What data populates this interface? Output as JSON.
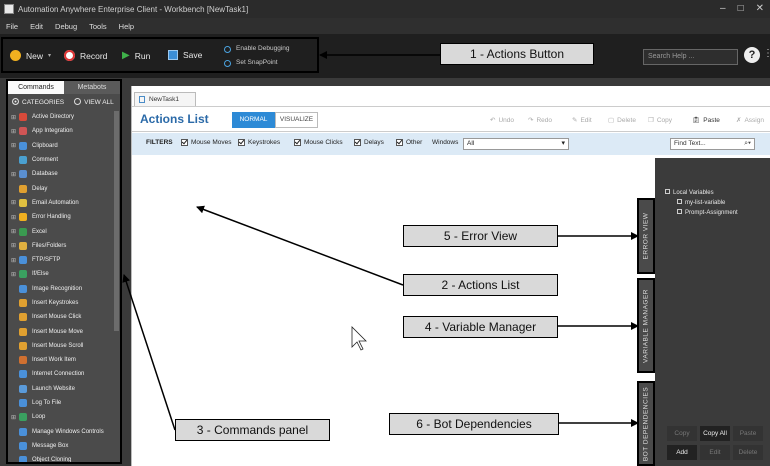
{
  "window": {
    "title": "Automation Anywhere Enterprise Client - Workbench [NewTask1]"
  },
  "menu": [
    "File",
    "Edit",
    "Debug",
    "Tools",
    "Help"
  ],
  "toolbar": {
    "new": "New",
    "record": "Record",
    "run": "Run",
    "save": "Save",
    "enable_debugging": "Enable Debugging",
    "set_snappoint": "Set SnapPoint",
    "search_placeholder": "Search Help ...",
    "help": "?"
  },
  "left_panel": {
    "tabs": [
      "Commands",
      "Metabots"
    ],
    "radio_categories": "CATEGORIES",
    "radio_view_all": "VIEW ALL",
    "commands": [
      "Active Directory",
      "App Integration",
      "Clipboard",
      "Comment",
      "Database",
      "Delay",
      "Email Automation",
      "Error Handling",
      "Excel",
      "Files/Folders",
      "FTP/SFTP",
      "If/Else",
      "Image Recognition",
      "Insert Keystrokes",
      "Insert Mouse Click",
      "Insert Mouse Move",
      "Insert Mouse Scroll",
      "Insert Work Item",
      "Internet Connection",
      "Launch Website",
      "Log To File",
      "Loop",
      "Manage Windows Controls",
      "Message Box",
      "Object Cloning"
    ]
  },
  "main": {
    "tab": "NewTask1",
    "title": "Actions List",
    "mode_normal": "NORMAL",
    "mode_visualize": "VISUALIZE",
    "tools": [
      "Undo",
      "Redo",
      "Edit",
      "Delete",
      "Copy",
      "Paste",
      "Assign"
    ],
    "filters_label": "FILTERS",
    "filters": [
      "Mouse Moves",
      "Keystrokes",
      "Mouse Clicks",
      "Delays",
      "Other"
    ],
    "windows_label": "Windows",
    "windows_value": "All",
    "find_placeholder": "Find Text..."
  },
  "right_panel": {
    "error_view": "ERROR VIEW",
    "variable_manager": "VARIABLE MANAGER",
    "bot_dependencies": "BOT DEPENDENCIES",
    "local_variables": "Local Variables",
    "variables": [
      "my-list-variable",
      "Prompt-Assignment"
    ],
    "buttons": [
      "Copy",
      "Copy All",
      "Paste",
      "Add",
      "Edit",
      "Delete"
    ]
  },
  "callouts": {
    "actions_button": "1 - Actions Button",
    "actions_list": "2 - Actions List",
    "commands_panel": "3 - Commands panel",
    "variable_manager": "4 - Variable Manager",
    "error_view": "5 - Error View",
    "bot_dependencies": "6 - Bot Dependencies"
  },
  "colors": {
    "accent": "#2d8ad6",
    "title_blue": "#2b6aa8",
    "filter_bar": "#dceaf6",
    "callout_bg": "#d9d9d9"
  }
}
